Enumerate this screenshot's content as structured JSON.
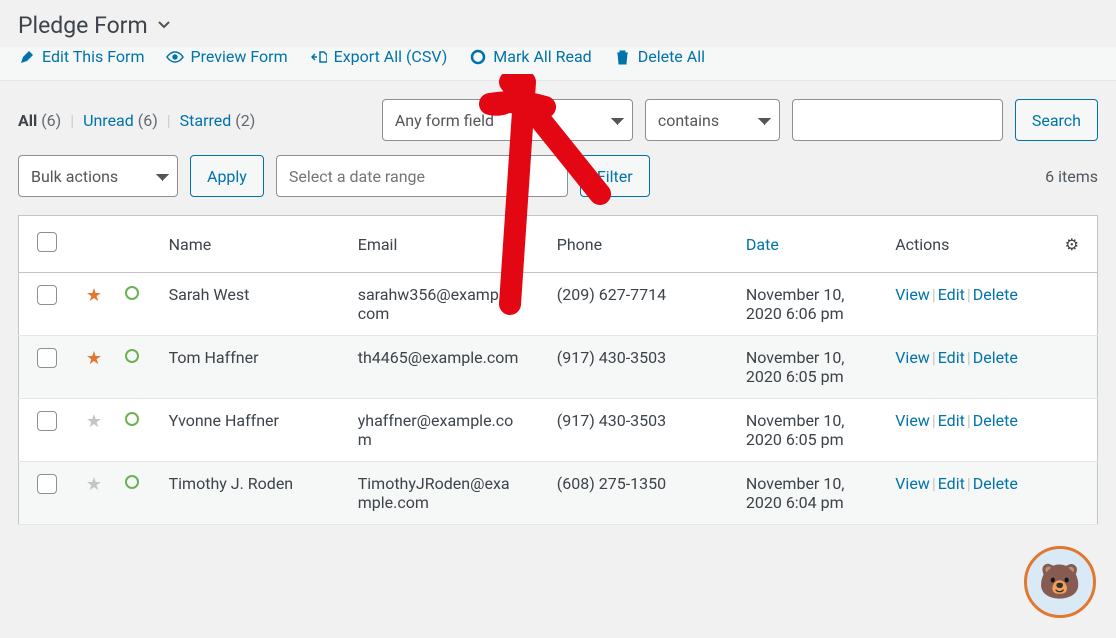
{
  "header": {
    "title": "Pledge Form"
  },
  "toolbar": {
    "edit": "Edit This Form",
    "preview": "Preview Form",
    "export": "Export All (CSV)",
    "markread": "Mark All Read",
    "delete": "Delete All"
  },
  "subsub": {
    "all_label": "All",
    "all_count": "(6)",
    "unread_label": "Unread",
    "unread_count": "(6)",
    "starred_label": "Starred",
    "starred_count": "(2)"
  },
  "filters": {
    "formfield": "Any form field",
    "contains": "contains",
    "search_btn": "Search",
    "bulk": "Bulk actions",
    "apply_btn": "Apply",
    "daterange_placeholder": "Select a date range",
    "filter_btn": "Filter",
    "items_count": "6 items"
  },
  "columns": {
    "name": "Name",
    "email": "Email",
    "phone": "Phone",
    "date": "Date",
    "actions": "Actions"
  },
  "actions": {
    "view": "View",
    "edit": "Edit",
    "delete": "Delete"
  },
  "rows": [
    {
      "starred": true,
      "name": "Sarah West",
      "email": "sarahw356@example.com",
      "phone": "(209) 627-7714",
      "date": "November 10, 2020 6:06 pm"
    },
    {
      "starred": true,
      "name": "Tom Haffner",
      "email": "th4465@example.com",
      "phone": "(917) 430-3503",
      "date": "November 10, 2020 6:05 pm"
    },
    {
      "starred": false,
      "name": "Yvonne Haffner",
      "email": "yhaffner@example.com",
      "phone": "(917) 430-3503",
      "date": "November 10, 2020 6:05 pm"
    },
    {
      "starred": false,
      "name": "Timothy J. Roden",
      "email": "TimothyJRoden@example.com",
      "phone": "(608) 275-1350",
      "date": "November 10, 2020 6:04 pm"
    }
  ]
}
